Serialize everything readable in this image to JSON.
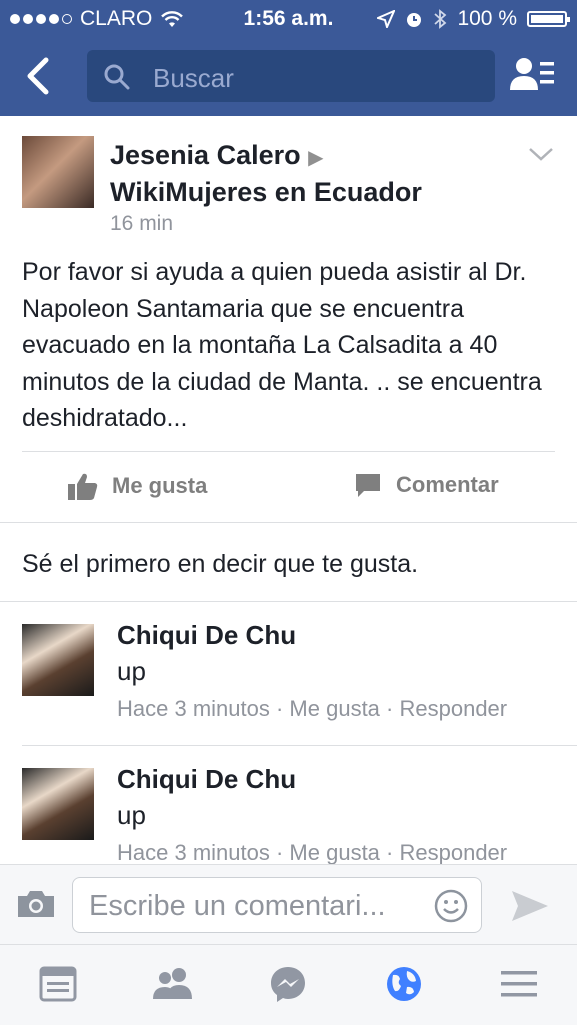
{
  "status_bar": {
    "carrier": "CLARO",
    "time": "1:56 a.m.",
    "battery": "100 %",
    "battery_level": 1.0,
    "icons": [
      "signal-dots",
      "wifi-icon",
      "location-icon",
      "alarm-icon",
      "bluetooth-icon",
      "battery-icon"
    ]
  },
  "navbar": {
    "back_icon": "chevron-left-icon",
    "search_placeholder": "Buscar",
    "friends_icon": "friend-requests-icon"
  },
  "post": {
    "author": "Jesenia Calero",
    "group": "WikiMujeres en Ecuador",
    "time": "16 min",
    "text": "Por favor si ayuda a quien pueda asistir al Dr. Napoleon Santamaria que se encuentra evacuado en la montaña La Calsadita a 40 minutos de la ciudad de Manta. .. se encuentra deshidratado...",
    "like_label": "Me gusta",
    "comment_label": "Comentar",
    "first_like_prompt": "Sé el primero en decir que te gusta."
  },
  "comments": [
    {
      "name": "Chiqui De Chu",
      "text": "up",
      "time": "Hace 3 minutos",
      "like": "Me gusta",
      "reply": "Responder"
    },
    {
      "name": "Chiqui De Chu",
      "text": "up",
      "time": "Hace 3 minutos",
      "like": "Me gusta",
      "reply": "Responder"
    }
  ],
  "composer": {
    "placeholder": "Escribe un comentari..."
  },
  "tabbar": {
    "tabs": [
      "news-feed-icon",
      "friends-icon",
      "messenger-icon",
      "globe-icon",
      "menu-icon"
    ],
    "active_color": "#4080ff",
    "inactive_color": "#9197a3"
  },
  "colors": {
    "brand": "#3b5998",
    "search_bg": "#29487d"
  }
}
